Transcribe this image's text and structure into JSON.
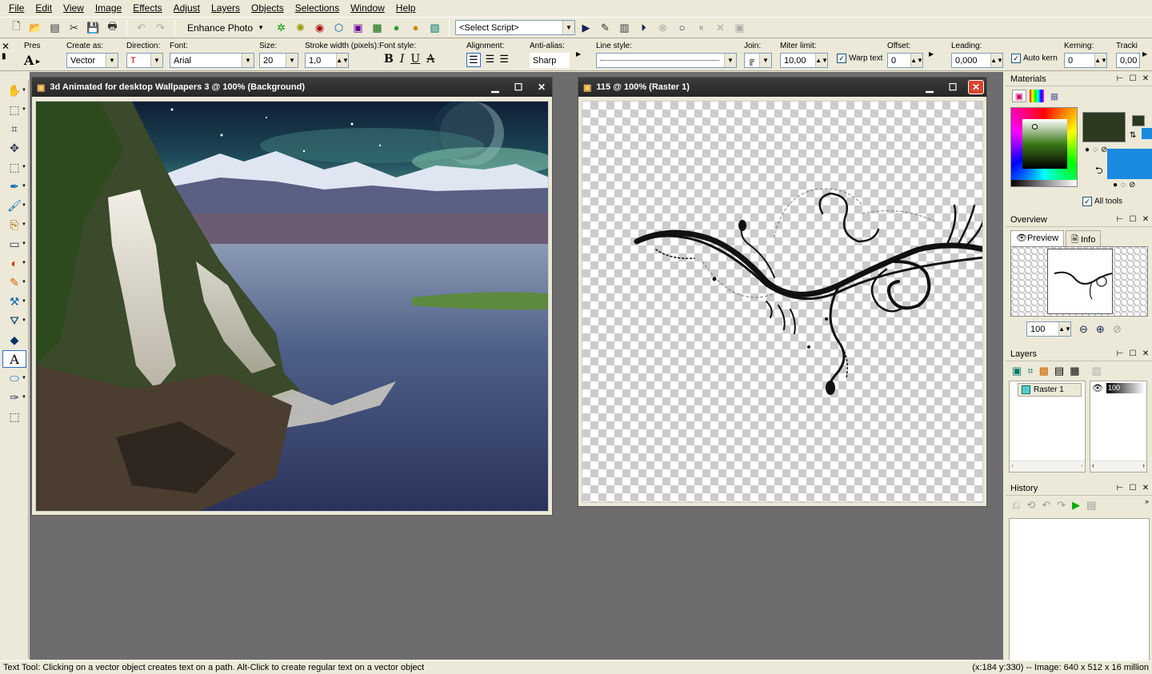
{
  "menu": [
    "File",
    "Edit",
    "View",
    "Image",
    "Effects",
    "Adjust",
    "Layers",
    "Objects",
    "Selections",
    "Window",
    "Help"
  ],
  "toolbar": {
    "enhance_label": "Enhance Photo",
    "script_select": "<Select Script>"
  },
  "tool_options": {
    "presets_label": "Pres",
    "create_as_label": "Create as:",
    "create_as_value": "Vector",
    "direction_label": "Direction:",
    "font_label": "Font:",
    "font_value": "Arial",
    "size_label": "Size:",
    "size_value": "20",
    "stroke_label": "Stroke width (pixels):",
    "stroke_value": "1,0",
    "font_style_label": "Font style:",
    "alignment_label": "Alignment:",
    "antialias_label": "Anti-alias:",
    "antialias_value": "Sharp",
    "line_style_label": "Line style:",
    "join_label": "Join:",
    "miter_label": "Miter limit:",
    "miter_value": "10,00",
    "warp_text_label": "Warp text",
    "offset_label": "Offset:",
    "offset_value": "0",
    "leading_label": "Leading:",
    "leading_value": "0,000",
    "auto_kern_label": "Auto kern",
    "kerning_label": "Kerning:",
    "kerning_value": "0",
    "tracking_label": "Tracki",
    "tracking_value": "0,00"
  },
  "documents": [
    {
      "title": "3d Animated for desktop Wallpapers 3 @ 100% (Background)"
    },
    {
      "title": "115 @ 100% (Raster 1)"
    }
  ],
  "palettes": {
    "materials": {
      "title": "Materials",
      "all_tools_label": "All tools",
      "foreground_color": "#2b3a1e",
      "background_color": "#1a8ae0"
    },
    "overview": {
      "title": "Overview",
      "tab_preview": "Preview",
      "tab_info": "Info",
      "zoom_value": "100"
    },
    "layers": {
      "title": "Layers",
      "layer_name": "Raster 1",
      "opacity": "100"
    },
    "history": {
      "title": "History"
    }
  },
  "status": {
    "message": "Text Tool: Clicking on a vector object creates text on a path. Alt-Click to create regular text on a vector object",
    "info": "(x:184 y:330) -- Image:  640 x 512 x 16 million"
  }
}
